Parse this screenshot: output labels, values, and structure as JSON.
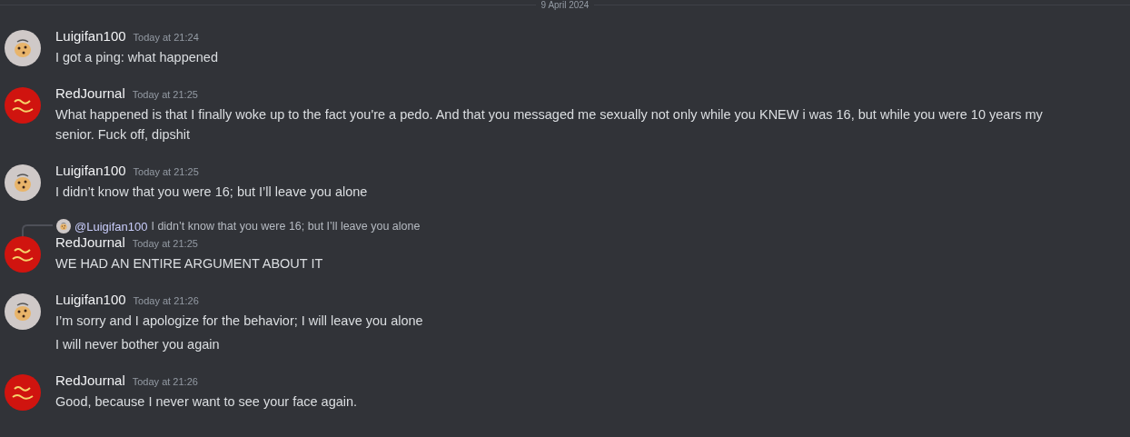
{
  "date_divider": "9 April 2024",
  "messages": [
    {
      "author": "Luigifan100",
      "kind": "cookie",
      "timestamp": "Today at 21:24",
      "lines": [
        "I got a ping: what happened"
      ]
    },
    {
      "author": "RedJournal",
      "kind": "logo",
      "timestamp": "Today at 21:25",
      "lines": [
        "What happened is that I finally woke up to the fact you're a pedo. And that you messaged me sexually not only while you KNEW i was 16, but while you were 10 years my senior. Fuck off, dipshit"
      ]
    },
    {
      "author": "Luigifan100",
      "kind": "cookie",
      "timestamp": "Today at 21:25",
      "lines": [
        "I didn’t know that you were 16; but I’ll leave you alone"
      ]
    },
    {
      "author": "RedJournal",
      "kind": "logo",
      "timestamp": "Today at 21:25",
      "reply": {
        "mention": "@Luigifan100",
        "kind": "cookie",
        "text": "I didn’t know that you were 16; but I’ll leave you alone"
      },
      "lines": [
        "WE HAD AN ENTIRE ARGUMENT ABOUT IT"
      ]
    },
    {
      "author": "Luigifan100",
      "kind": "cookie",
      "timestamp": "Today at 21:26",
      "lines": [
        "I’m sorry and I apologize for the behavior; I will leave you alone",
        "I will never bother you again"
      ]
    },
    {
      "author": "RedJournal",
      "kind": "logo",
      "timestamp": "Today at 21:26",
      "lines": [
        "Good, because I never want to see your face again."
      ]
    }
  ]
}
